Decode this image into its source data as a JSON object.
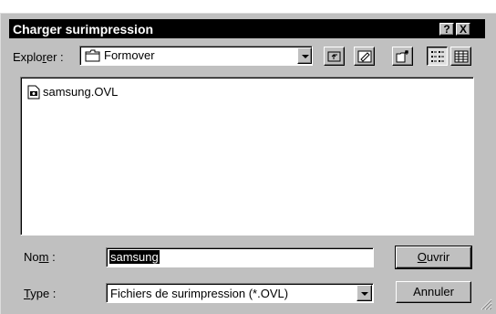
{
  "dialog": {
    "title": "Charger surimpression",
    "help_label": "?",
    "close_label": "X"
  },
  "lookin": {
    "label_pre": "Explo",
    "label_underline": "r",
    "label_post": "er :",
    "value": "Formover"
  },
  "files": [
    {
      "name": "samsung.OVL"
    }
  ],
  "filename": {
    "label_pre": "No",
    "label_underline": "m",
    "label_post": " :",
    "value": "samsung"
  },
  "filetype": {
    "label_underline": "T",
    "label_post": "ype :",
    "value": "Fichiers de surimpression (*.OVL)"
  },
  "buttons": {
    "open_underline": "O",
    "open_post": "uvrir",
    "cancel": "Annuler"
  }
}
